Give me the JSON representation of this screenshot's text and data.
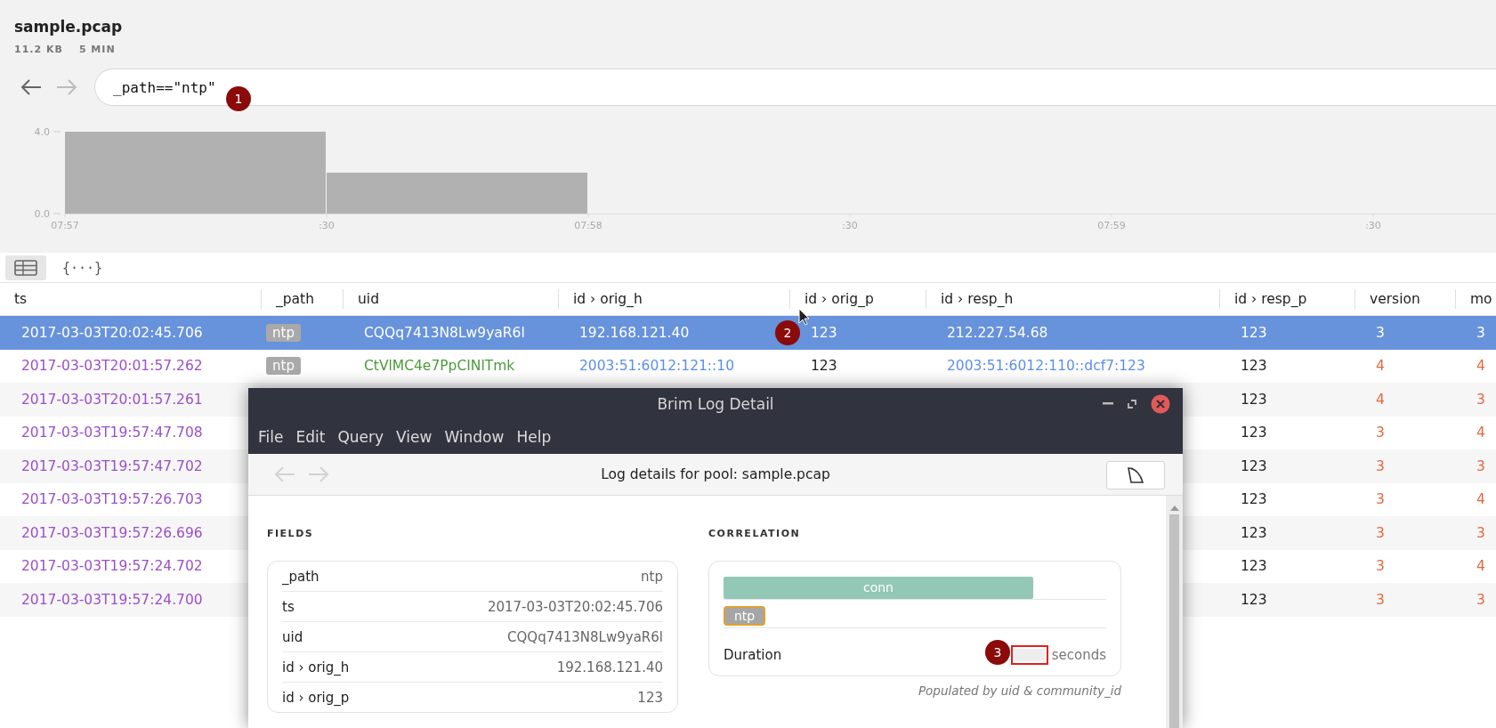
{
  "pool": {
    "name": "sample.pcap",
    "size": "11.2 KB",
    "span": "5 MIN"
  },
  "query": {
    "back_enabled": true,
    "forward_enabled": false,
    "value": "_path==\"ntp\""
  },
  "histogram": {
    "chart_data": {
      "type": "bar",
      "categories": [
        "07:57",
        ":30",
        "07:58",
        ":30",
        "07:59",
        ":30"
      ],
      "values": [
        4,
        2,
        0,
        0,
        0,
        0
      ],
      "ylim": [
        0,
        4
      ],
      "yticks": [
        {
          "value": 0,
          "label": "0.0"
        },
        {
          "value": 4,
          "label": "4.0"
        }
      ]
    }
  },
  "view_tabs": [
    {
      "kind": "table",
      "selected": true
    },
    {
      "kind": "json",
      "label": "{···}",
      "selected": false
    }
  ],
  "table": {
    "columns": [
      "ts",
      "_path",
      "uid",
      "id › orig_h",
      "id › orig_p",
      "id › resp_h",
      "id › resp_p",
      "version",
      "mo"
    ],
    "rows": [
      {
        "selected": true,
        "ts": "2017-03-03T20:02:45.706",
        "path": "ntp",
        "uid": "CQQq7413N8Lw9yaR6l",
        "orig_h": "192.168.121.40",
        "orig_p": "123",
        "resp_h": "212.227.54.68",
        "resp_p": "123",
        "version": "3",
        "mode": "3"
      },
      {
        "selected": false,
        "ts": "2017-03-03T20:01:57.262",
        "path": "ntp",
        "uid": "CtVlMC4e7PpCINlTmk",
        "orig_h": "2003:51:6012:121::10",
        "orig_p": "123",
        "resp_h": "2003:51:6012:110::dcf7:123",
        "resp_p": "123",
        "version": "4",
        "mode": "4"
      },
      {
        "selected": false,
        "ts": "2017-03-03T20:01:57.261",
        "resp_p": "123",
        "version": "4",
        "mode": "3"
      },
      {
        "selected": false,
        "ts": "2017-03-03T19:57:47.708",
        "resp_p": "123",
        "version": "3",
        "mode": "4"
      },
      {
        "selected": false,
        "ts": "2017-03-03T19:57:47.702",
        "resp_p": "123",
        "version": "3",
        "mode": "3"
      },
      {
        "selected": false,
        "ts": "2017-03-03T19:57:26.703",
        "resp_p": "123",
        "version": "3",
        "mode": "4"
      },
      {
        "selected": false,
        "ts": "2017-03-03T19:57:26.696",
        "resp_p": "123",
        "version": "3",
        "mode": "3"
      },
      {
        "selected": false,
        "ts": "2017-03-03T19:57:24.702",
        "resp_p": "123",
        "version": "3",
        "mode": "4"
      },
      {
        "selected": false,
        "ts": "2017-03-03T19:57:24.700",
        "resp_p": "123",
        "version": "3",
        "mode": "3"
      }
    ]
  },
  "detail_window": {
    "title": "Brim Log Detail",
    "menu": [
      "File",
      "Edit",
      "Query",
      "View",
      "Window",
      "Help"
    ],
    "heading": "Log details for pool: sample.pcap",
    "fields_title": "FIELDS",
    "fields": [
      {
        "name": "_path",
        "value": "ntp"
      },
      {
        "name": "ts",
        "value": "2017-03-03T20:02:45.706"
      },
      {
        "name": "uid",
        "value": "CQQq7413N8Lw9yaR6l"
      },
      {
        "name": "id › orig_h",
        "value": "192.168.121.40"
      },
      {
        "name": "id › orig_p",
        "value": "123"
      }
    ],
    "correlation_title": "CORRELATION",
    "timeline": [
      {
        "kind": "bar",
        "label": "conn",
        "selected": false
      },
      {
        "kind": "tag",
        "label": "ntp",
        "selected": true
      }
    ],
    "duration": {
      "label": "Duration",
      "unit": "seconds",
      "highlighted": true
    },
    "note": "Populated by uid & community_id"
  },
  "annotations": [
    {
      "label": "1"
    },
    {
      "label": "2"
    },
    {
      "label": "3"
    }
  ]
}
